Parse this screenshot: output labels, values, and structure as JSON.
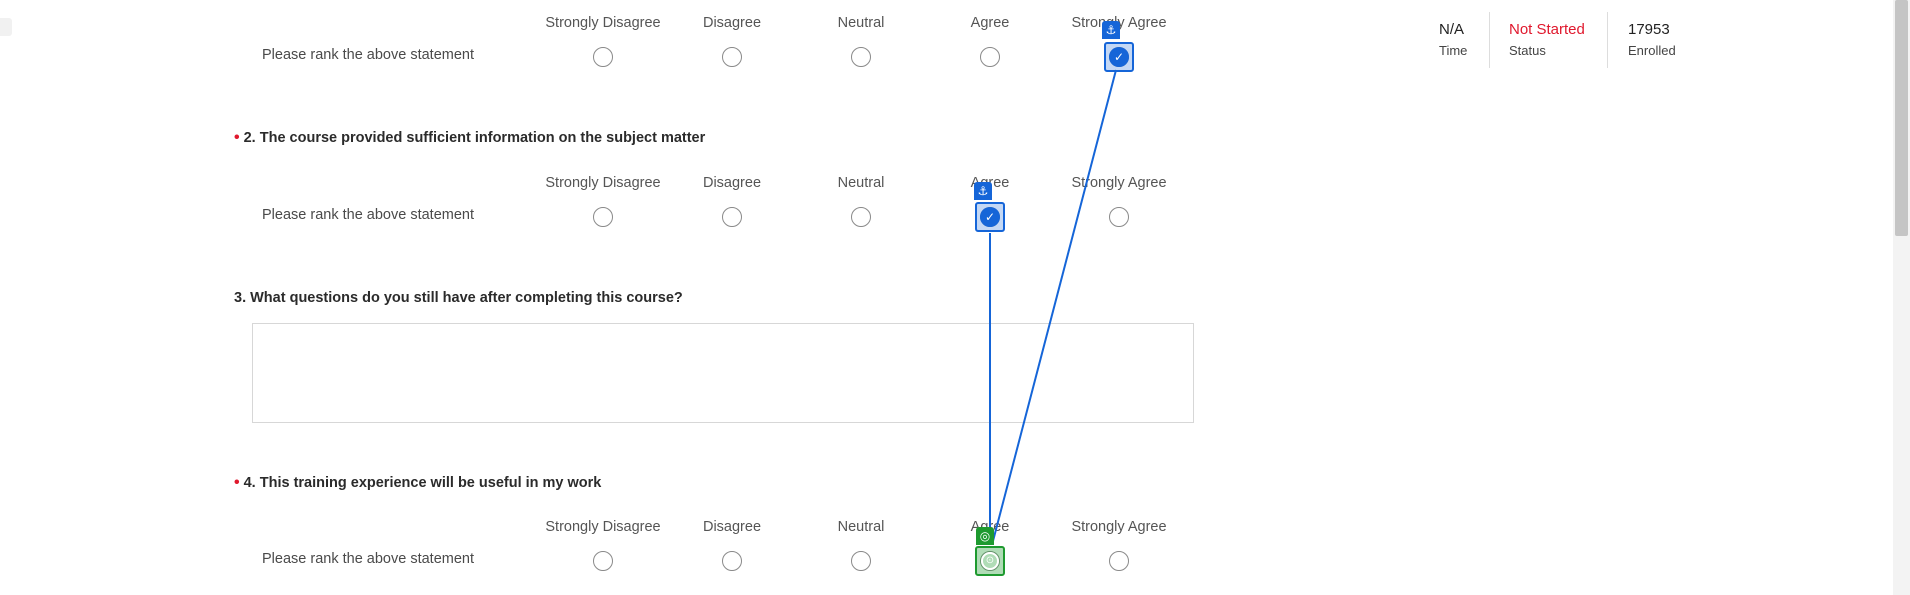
{
  "scale": [
    "Strongly Disagree",
    "Disagree",
    "Neutral",
    "Agree",
    "Strongly Agree"
  ],
  "rank_prompt": "Please rank the above statement",
  "questions": {
    "q1": {
      "selected": "Strongly Agree"
    },
    "q2": {
      "required": true,
      "title": "2. The course provided sufficient information on the subject matter",
      "selected": "Agree"
    },
    "q3": {
      "required": false,
      "title": "3. What questions do you still have after completing this course?",
      "answer": ""
    },
    "q4": {
      "required": true,
      "title": "4. This training experience will be useful in my work",
      "selected": ""
    }
  },
  "required_marker": "•",
  "stats": {
    "time": {
      "value": "N/A",
      "label": "Time"
    },
    "status": {
      "value": "Not Started",
      "label": "Status",
      "color": "#e0182d"
    },
    "enrolled": {
      "value": "17953",
      "label": "Enrolled"
    }
  },
  "overlay": {
    "anchor_icon": "anchor-icon",
    "check_icon": "check-icon",
    "target_icon": "crosshair-icon",
    "line_color": "#1565d8",
    "anchor_color": "#1565d8",
    "target_color": "#1e9a2f"
  }
}
